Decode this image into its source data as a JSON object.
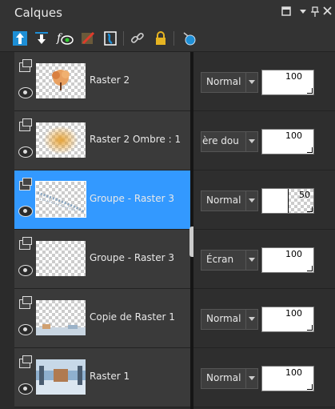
{
  "panel": {
    "title": "Calques"
  },
  "window_controls": [
    "square-icon",
    "dropdown-icon",
    "pin-icon",
    "close-icon"
  ],
  "toolbar": [
    "move-layer-up-icon",
    "move-layer-down-icon",
    "visibility-fx-icon",
    "delete-layer-icon",
    "mask-icon",
    "link-icon",
    "lock-icon",
    "new-layer-icon"
  ],
  "layers": [
    {
      "name": "Raster 2",
      "blend": "Normal",
      "opacity": 100,
      "selected": false,
      "thumb": "tree"
    },
    {
      "name": "Raster 2 Ombre : 1",
      "blend": "mière dou",
      "opacity": 100,
      "selected": false,
      "thumb": "glow"
    },
    {
      "name": "Groupe - Raster 3",
      "blend": "Normal",
      "opacity": 50,
      "selected": true,
      "thumb": "snow"
    },
    {
      "name": "Groupe - Raster 3",
      "blend": "Écran",
      "opacity": 100,
      "selected": false,
      "thumb": "empty"
    },
    {
      "name": "Copie de Raster 1",
      "blend": "Normal",
      "opacity": 100,
      "selected": false,
      "thumb": "bottomstrip"
    },
    {
      "name": "Raster 1",
      "blend": "Normal",
      "opacity": 100,
      "selected": false,
      "thumb": "scene"
    }
  ],
  "colors": {
    "selection": "#3399ff",
    "panel_bg": "#2b2b2b",
    "row_bg": "#3a3a3a"
  }
}
